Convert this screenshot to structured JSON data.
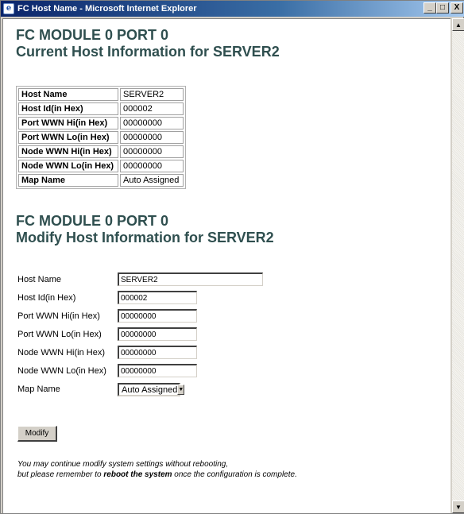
{
  "window": {
    "title": "FC Host Name - Microsoft Internet Explorer",
    "minimize": "_",
    "maximize": "□",
    "close": "X"
  },
  "current": {
    "heading_line1": "FC MODULE 0 PORT 0",
    "heading_line2": "Current Host Information for SERVER2",
    "rows": [
      {
        "key": "Host Name",
        "value": "SERVER2"
      },
      {
        "key": "Host Id(in Hex)",
        "value": "000002"
      },
      {
        "key": "Port WWN Hi(in Hex)",
        "value": "00000000"
      },
      {
        "key": "Port WWN Lo(in Hex)",
        "value": "00000000"
      },
      {
        "key": "Node WWN Hi(in Hex)",
        "value": "00000000"
      },
      {
        "key": "Node WWN Lo(in Hex)",
        "value": "00000000"
      },
      {
        "key": "Map Name",
        "value": "Auto Assigned"
      }
    ]
  },
  "modify": {
    "heading_line1": "FC MODULE 0 PORT 0",
    "heading_line2": "Modify Host Information for SERVER2",
    "fields": [
      {
        "label": "Host Name",
        "value": "SERVER2"
      },
      {
        "label": "Host Id(in Hex)",
        "value": "000002"
      },
      {
        "label": "Port WWN Hi(in Hex)",
        "value": "00000000"
      },
      {
        "label": "Port WWN Lo(in Hex)",
        "value": "00000000"
      },
      {
        "label": "Node WWN Hi(in Hex)",
        "value": "00000000"
      },
      {
        "label": "Node WWN Lo(in Hex)",
        "value": "00000000"
      }
    ],
    "map_label": "Map Name",
    "map_selected": "Auto Assigned",
    "button_label": "Modify"
  },
  "note": {
    "line1": "You may continue modify system settings without rebooting,",
    "line2_pre": "but please remember to ",
    "line2_bold": "reboot the system",
    "line2_post": " once the configuration is complete."
  },
  "icons": {
    "app": "ie-page-icon",
    "scroll_up": "▲",
    "scroll_down": "▼",
    "dropdown": "▼"
  }
}
